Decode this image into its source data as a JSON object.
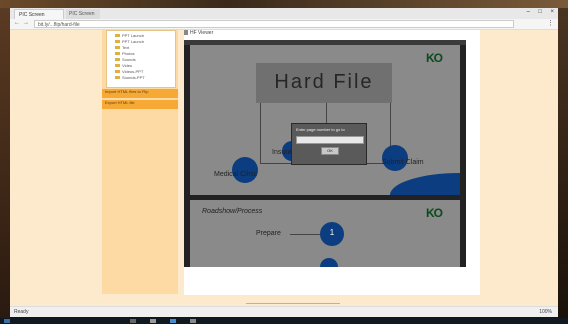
{
  "browser": {
    "tabs": [
      {
        "label": "PIC Screen"
      },
      {
        "label": "PIC Screen"
      }
    ],
    "window_controls": [
      "–",
      "□",
      "×"
    ],
    "url": "bit.ly/...flip/hard-file",
    "menu_icon": "menu-icon"
  },
  "sidebar": {
    "tree_items": [
      "PPT Launch",
      "PPT Launch",
      "Text",
      "Photos",
      "Sounds",
      "Video",
      "Videos-PPT",
      "Sounds-PPT"
    ],
    "buttons": [
      {
        "label": "Import HTML files to Flip"
      },
      {
        "label": "Export HTML file"
      }
    ]
  },
  "viewer": {
    "title": "HF Viewer",
    "slide1": {
      "logo": "KO",
      "heading": "Hard File",
      "labels": [
        "Medical Clinic",
        "Insurance",
        "Submit Claim"
      ]
    },
    "slide2": {
      "logo": "KO",
      "title": "Roadshow/Process",
      "labels": [
        "Prepare"
      ],
      "steps": [
        "1"
      ]
    },
    "dialog": {
      "title": "Enter page number to go to",
      "ok_label": "OK"
    }
  },
  "statusbar": {
    "left": "Ready",
    "right": "100%"
  },
  "colors": {
    "accent_orange": "#f7a935",
    "sidebar_bg": "#fdd9a4",
    "page_bg": "#fde9cc",
    "slide_circle": "#0b3d80",
    "logo_green": "#0b4a1e"
  }
}
